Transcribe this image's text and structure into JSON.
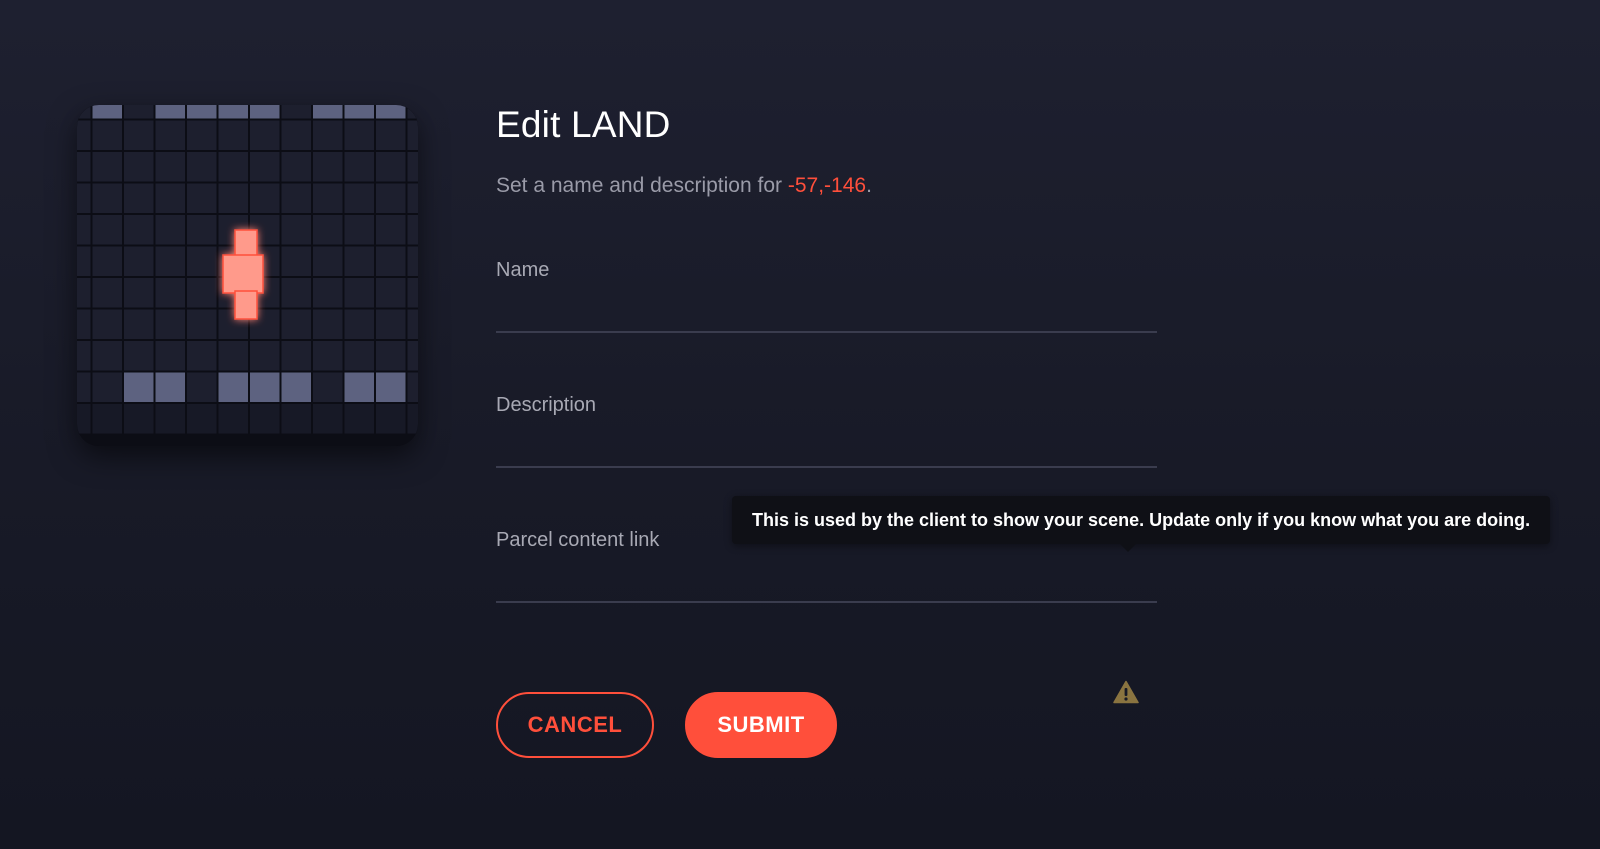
{
  "page": {
    "title": "Edit LAND",
    "subtitle_prefix": "Set a name and description for ",
    "coordinates": "-57,-146",
    "subtitle_suffix": "."
  },
  "fields": {
    "name": {
      "label": "Name",
      "value": ""
    },
    "description": {
      "label": "Description",
      "value": ""
    },
    "content_link": {
      "label": "Parcel content link",
      "value": "",
      "warning_icon": "warning-triangle-icon"
    }
  },
  "tooltip": {
    "text": "This is used by the client to show your scene. Update only if you know what you are doing."
  },
  "buttons": {
    "cancel": "CANCEL",
    "submit": "SUBMIT"
  },
  "map": {
    "highlighted_parcel": "-57,-146",
    "colors": {
      "empty": "#1d1f2e",
      "owned": "#5d6280",
      "selected": "#ff9a8b",
      "selected_glow": "#ff4f3b"
    }
  },
  "colors": {
    "accent": "#ff4f3b",
    "muted_text": "#9a9ba8",
    "warning": "#8a7440"
  }
}
